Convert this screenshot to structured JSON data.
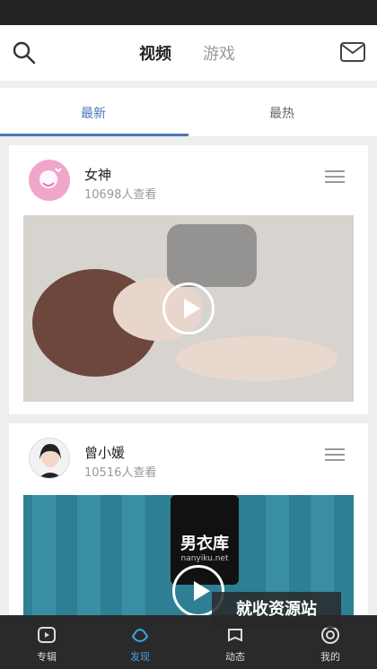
{
  "top_tabs": {
    "video": "视频",
    "game": "游戏"
  },
  "sub_tabs": {
    "latest": "最新",
    "hot": "最热"
  },
  "feed": [
    {
      "name": "女神",
      "views": "10698人查看"
    },
    {
      "name": "曾小媛",
      "views": "10516人查看",
      "logo_text": "男衣库",
      "logo_sub": "nanyiku.net"
    }
  ],
  "watermark": "就收资源站",
  "bottom_nav": [
    {
      "label": "专辑",
      "icon": "play-square-icon"
    },
    {
      "label": "发现",
      "icon": "discover-icon"
    },
    {
      "label": "动态",
      "icon": "activity-icon"
    },
    {
      "label": "我的",
      "icon": "profile-icon"
    }
  ],
  "colors": {
    "accent": "#4a77b8",
    "nav_active": "#3fa2e6"
  }
}
